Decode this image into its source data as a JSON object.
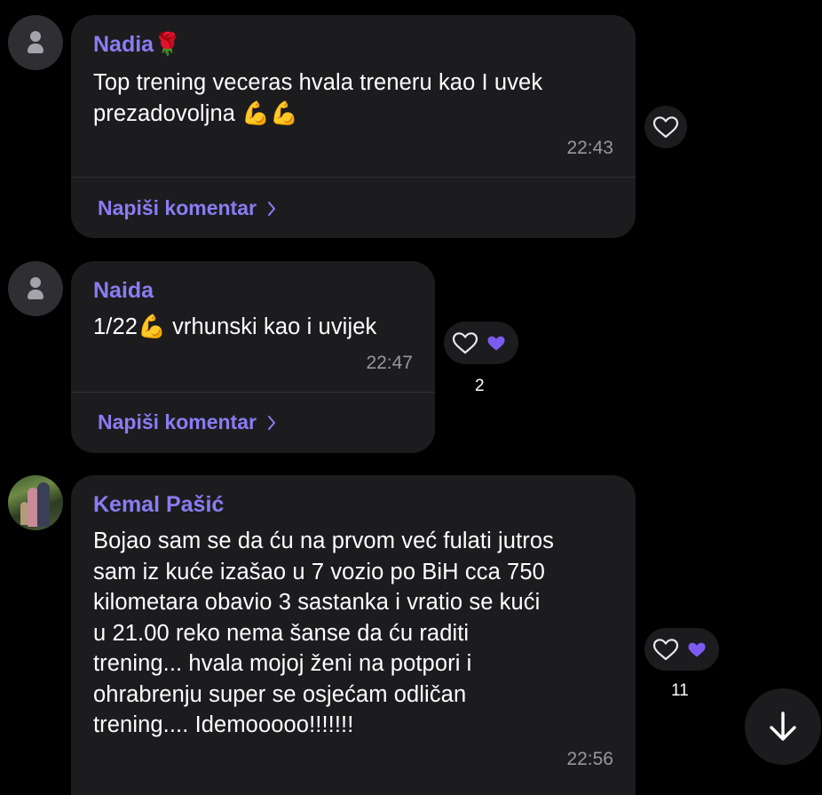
{
  "messages": [
    {
      "author": "Nadia",
      "author_emoji": "🌹",
      "text": "Top trening veceras hvala treneru kao I uvek\nprezadovoljna 💪💪",
      "time": "22:43",
      "comment_label": "Napiši komentar",
      "reaction_count": ""
    },
    {
      "author": "Naida",
      "author_emoji": "",
      "text": "1/22💪 vrhunski kao i uvijek",
      "time": "22:47",
      "comment_label": "Napiši komentar",
      "reaction_count": "2"
    },
    {
      "author": "Kemal Pašić",
      "author_emoji": "",
      "text": "Bojao sam se da ću na prvom već fulati jutros\nsam iz kuće izašao u 7 vozio po BiH cca 750\nkilometara obavio 3 sastanka i vratio se kući\nu 21.00 reko nema šanse da ću raditi\ntrening... hvala mojoj ženi na potpori i\nohrabrenju super se osjećam odličan\ntrening.... Idemooooo!!!!!!!",
      "time": "22:56",
      "comment_label": "",
      "reaction_count": "11"
    }
  ],
  "icons": {
    "heart": "heart-outline-icon",
    "reacted_heart": "purple-heart-icon",
    "chevron": "chevron-right-icon",
    "scroll": "arrow-down-icon",
    "avatar": "user-placeholder-icon"
  },
  "colors": {
    "background": "#000000",
    "bubble": "#1c1c1f",
    "accent": "#8b7cf2",
    "timestamp": "#97979d"
  }
}
